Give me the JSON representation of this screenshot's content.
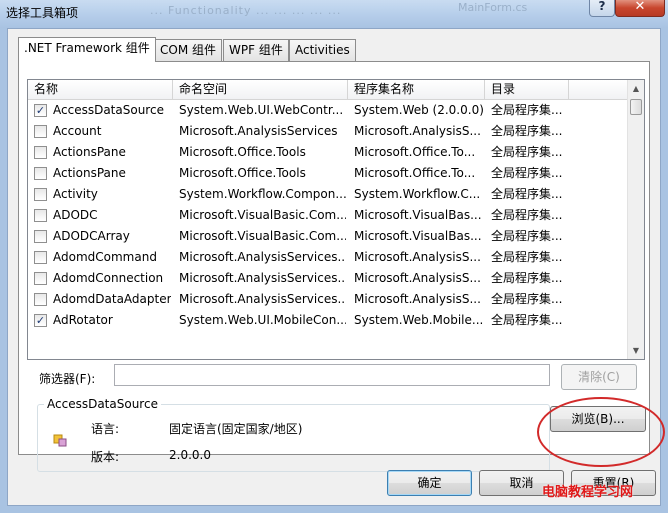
{
  "window": {
    "title": "选择工具箱项",
    "ghost_text": "... Functionality ... ... ... ... ...",
    "ghost_text2": "MainForm.cs",
    "help_glyph": "?",
    "close_glyph": "✕"
  },
  "tabs": [
    {
      "label": ".NET Framework 组件",
      "active": true
    },
    {
      "label": "COM 组件",
      "active": false
    },
    {
      "label": "WPF 组件",
      "active": false
    },
    {
      "label": "Activities",
      "active": false
    }
  ],
  "table": {
    "columns": [
      "名称",
      "命名空间",
      "程序集名称",
      "目录"
    ],
    "rows": [
      {
        "checked": true,
        "name": "AccessDataSource",
        "namespace": "System.Web.UI.WebContr...",
        "assembly": "System.Web (2.0.0.0)",
        "directory": "全局程序集..."
      },
      {
        "checked": false,
        "name": "Account",
        "namespace": "Microsoft.AnalysisServices",
        "assembly": "Microsoft.AnalysisS...",
        "directory": "全局程序集..."
      },
      {
        "checked": false,
        "name": "ActionsPane",
        "namespace": "Microsoft.Office.Tools",
        "assembly": "Microsoft.Office.To...",
        "directory": "全局程序集..."
      },
      {
        "checked": false,
        "name": "ActionsPane",
        "namespace": "Microsoft.Office.Tools",
        "assembly": "Microsoft.Office.To...",
        "directory": "全局程序集..."
      },
      {
        "checked": false,
        "name": "Activity",
        "namespace": "System.Workflow.Compon...",
        "assembly": "System.Workflow.C...",
        "directory": "全局程序集..."
      },
      {
        "checked": false,
        "name": "ADODC",
        "namespace": "Microsoft.VisualBasic.Com...",
        "assembly": "Microsoft.VisualBas...",
        "directory": "全局程序集..."
      },
      {
        "checked": false,
        "name": "ADODCArray",
        "namespace": "Microsoft.VisualBasic.Com...",
        "assembly": "Microsoft.VisualBas...",
        "directory": "全局程序集..."
      },
      {
        "checked": false,
        "name": "AdomdCommand",
        "namespace": "Microsoft.AnalysisServices...",
        "assembly": "Microsoft.AnalysisS...",
        "directory": "全局程序集..."
      },
      {
        "checked": false,
        "name": "AdomdConnection",
        "namespace": "Microsoft.AnalysisServices...",
        "assembly": "Microsoft.AnalysisS...",
        "directory": "全局程序集..."
      },
      {
        "checked": false,
        "name": "AdomdDataAdapter",
        "namespace": "Microsoft.AnalysisServices...",
        "assembly": "Microsoft.AnalysisS...",
        "directory": "全局程序集..."
      },
      {
        "checked": true,
        "name": "AdRotator",
        "namespace": "System.Web.UI.MobileCon...",
        "assembly": "System.Web.Mobile...",
        "directory": "全局程序集..."
      }
    ]
  },
  "filter": {
    "label": "筛选器(F):",
    "value": "",
    "clear_label": "清除(C)"
  },
  "details": {
    "title": "AccessDataSource",
    "language_label": "语言:",
    "language_value": "固定语言(固定国家/地区)",
    "version_label": "版本:",
    "version_value": "2.0.0.0",
    "icon": "component-icon"
  },
  "buttons": {
    "browse": "浏览(B)...",
    "ok": "确定",
    "cancel": "取消",
    "reset": "重置(R)"
  },
  "watermark": "电脑教程学习网",
  "colors": {
    "annotation": "#d22a2a",
    "title_bar": "#b5cdea",
    "close_button": "#c8462e",
    "default_button_border": "#3c7fb1"
  }
}
